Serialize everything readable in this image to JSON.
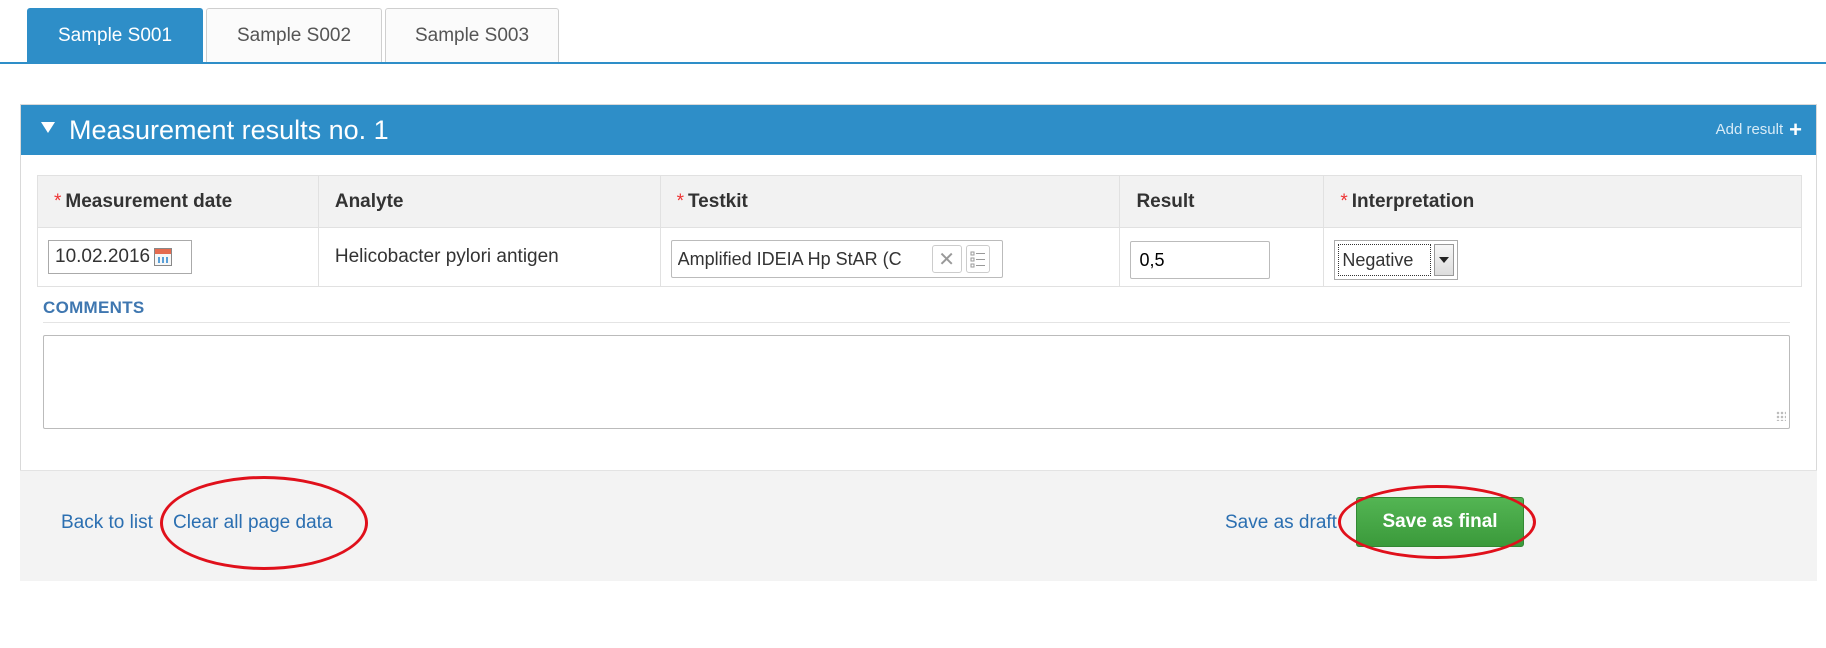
{
  "tabs": [
    {
      "label": "Sample S001",
      "active": true
    },
    {
      "label": "Sample S002",
      "active": false
    },
    {
      "label": "Sample S003",
      "active": false
    }
  ],
  "panel": {
    "title": "Measurement results no. 1",
    "add_result_label": "Add result",
    "add_icon": "plus-icon",
    "collapse_icon": "caret-down-icon"
  },
  "table": {
    "headers": {
      "date": "Measurement date",
      "analyte": "Analyte",
      "testkit": "Testkit",
      "result": "Result",
      "interpretation": "Interpretation"
    },
    "required_marker": "*",
    "row": {
      "date": "10.02.2016",
      "analyte": "Helicobacter pylori antigen",
      "testkit": "Amplified IDEIA Hp StAR (C",
      "result": "0,5",
      "interpretation": "Negative"
    }
  },
  "comments": {
    "label": "COMMENTS",
    "value": ""
  },
  "footer": {
    "back_label": "Back to list",
    "clear_label": "Clear all page data",
    "save_draft_label": "Save as draft",
    "save_final_label": "Save as final"
  },
  "colors": {
    "accent": "#2e8ec8",
    "required": "#e33333",
    "save_final": "#45a845",
    "link": "#2b6fb1",
    "annotation": "#e0101b"
  }
}
